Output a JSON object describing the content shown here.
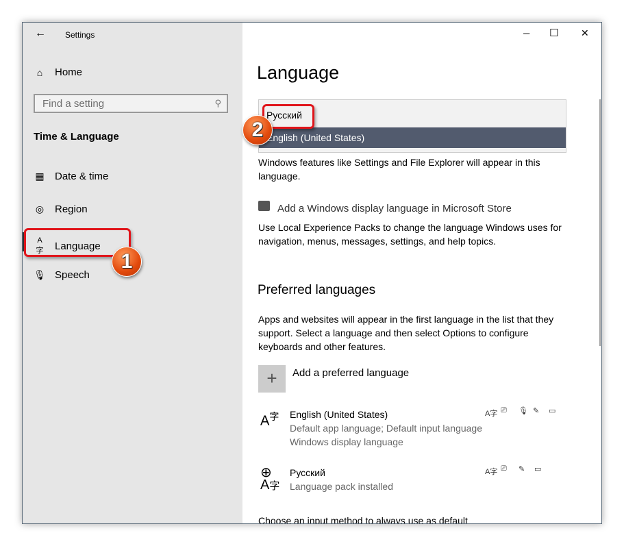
{
  "titlebar": {
    "title": "Settings",
    "back_icon": "arrow-left",
    "minimize": "─",
    "maximize": "☐",
    "close": "✕"
  },
  "sidebar": {
    "home": "Home",
    "search_placeholder": "Find a setting",
    "section_title": "Time & Language",
    "items": [
      {
        "label": "Date & time",
        "icon": "calendar-clock"
      },
      {
        "label": "Region",
        "icon": "globe"
      },
      {
        "label": "Language",
        "icon": "language"
      },
      {
        "label": "Speech",
        "icon": "microphone"
      }
    ]
  },
  "main": {
    "title": "Language",
    "display_dropdown": {
      "options": [
        "Русский",
        "English (United States)"
      ],
      "selected": "English (United States)"
    },
    "display_desc": "Windows features like Settings and File Explorer will appear in this language.",
    "store_link": "Add a Windows display language in Microsoft Store",
    "store_desc": "Use Local Experience Packs to change the language Windows uses for navigation, menus, messages, settings, and help topics.",
    "preferred_title": "Preferred languages",
    "preferred_desc": "Apps and websites will appear in the first language in the list that they support. Select a language and then select Options to configure keyboards and other features.",
    "add_language": "Add a preferred language",
    "languages": [
      {
        "name": "English (United States)",
        "line1": "Default app language; Default input language",
        "line2": "Windows display language"
      },
      {
        "name": "Русский",
        "line1": "Language pack installed"
      }
    ],
    "input_method_link": "Choose an input method to always use as default"
  },
  "annotations": {
    "step1": "1",
    "step2": "2",
    "accent": "#e0151b"
  }
}
